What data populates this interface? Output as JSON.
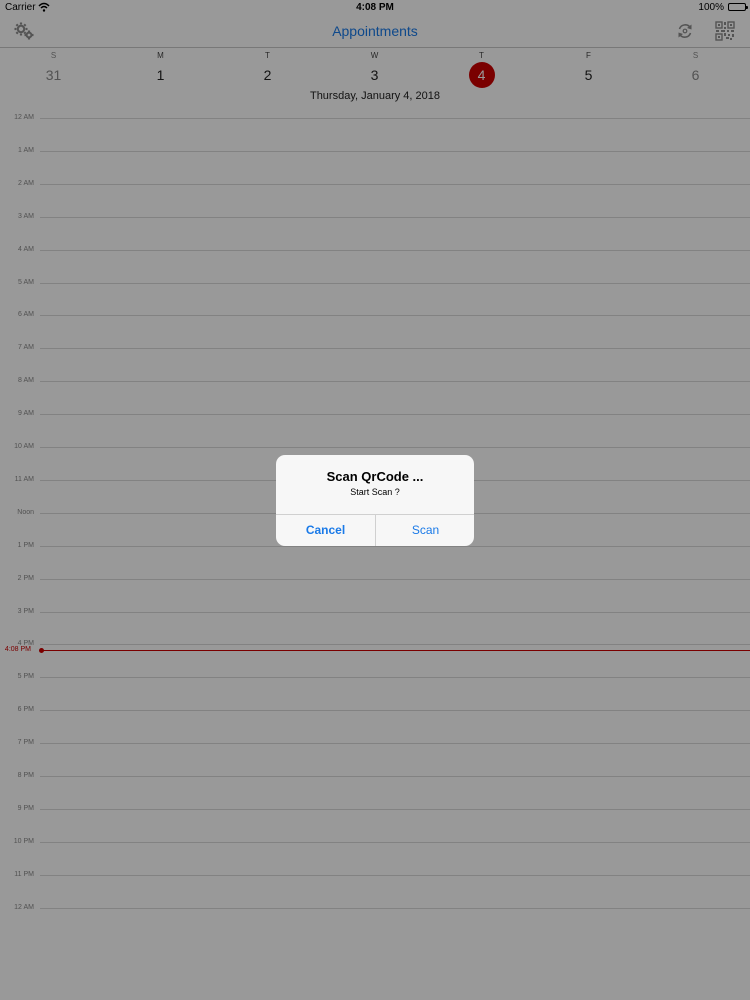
{
  "status_bar": {
    "carrier": "Carrier",
    "time": "4:08 PM",
    "battery": "100%"
  },
  "nav": {
    "title": "Appointments",
    "left_icon": "gear-icon",
    "right_icons": [
      "sync-icon",
      "qr-code-icon"
    ]
  },
  "week": {
    "days": [
      {
        "letter": "S",
        "num": "31"
      },
      {
        "letter": "M",
        "num": "1"
      },
      {
        "letter": "T",
        "num": "2"
      },
      {
        "letter": "W",
        "num": "3"
      },
      {
        "letter": "T",
        "num": "4"
      },
      {
        "letter": "F",
        "num": "5"
      },
      {
        "letter": "S",
        "num": "6"
      }
    ],
    "selected_date_label": "Thursday, January 4, 2018"
  },
  "timeline": {
    "hours": [
      "12 AM",
      "1 AM",
      "2 AM",
      "3 AM",
      "4 AM",
      "5 AM",
      "6 AM",
      "7 AM",
      "8 AM",
      "9 AM",
      "10 AM",
      "11 AM",
      "Noon",
      "1 PM",
      "2 PM",
      "3 PM",
      "4 PM",
      "5 PM",
      "6 PM",
      "7 PM",
      "8 PM",
      "9 PM",
      "10 PM",
      "11 PM",
      "12 AM"
    ],
    "current_time": "4:08 PM"
  },
  "alert": {
    "title": "Scan QrCode ...",
    "message": "Start Scan ?",
    "cancel": "Cancel",
    "confirm": "Scan"
  },
  "colors": {
    "accent": "#1a7ae8",
    "today": "#cc0000"
  }
}
